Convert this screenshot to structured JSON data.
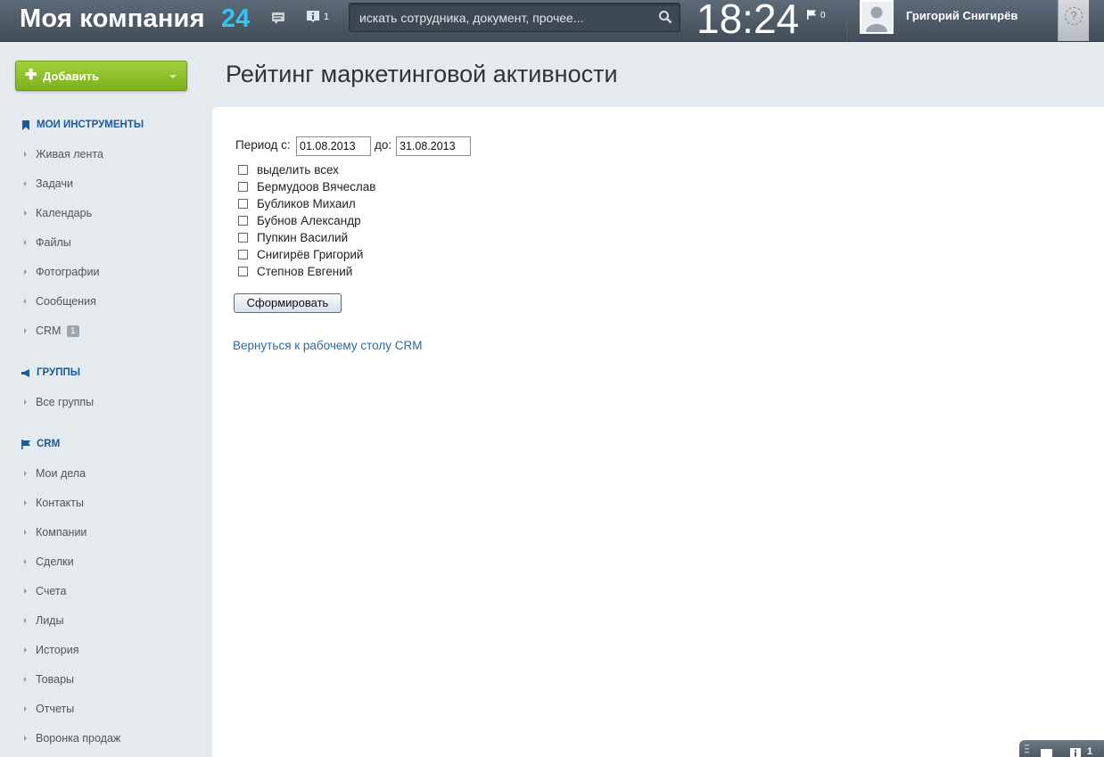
{
  "header": {
    "company": "Моя компания",
    "company_num": "24",
    "notifications_count": "1",
    "search_placeholder": "искать сотрудника, документ, прочее...",
    "clock": "18:24",
    "flags_count": "0",
    "user_name": "Григорий Снигирёв",
    "help_label": "?"
  },
  "sidebar": {
    "add_button": "Добавить",
    "sections": [
      {
        "title": "МОИ ИНСТРУМЕНТЫ",
        "items": [
          "Живая лента",
          "Задачи",
          "Календарь",
          "Файлы",
          "Фотографии",
          "Сообщения",
          "CRM"
        ]
      },
      {
        "title": "ГРУППЫ",
        "items": [
          "Все группы"
        ]
      },
      {
        "title": "CRM",
        "items": [
          "Мои дела",
          "Контакты",
          "Компании",
          "Сделки",
          "Счета",
          "Лиды",
          "История",
          "Товары",
          "Отчеты",
          "Воронка продаж"
        ]
      }
    ],
    "crm_badge": "1"
  },
  "main": {
    "title": "Рейтинг маркетинговой активности",
    "period_from_label": "Период с:",
    "date_from": "01.08.2013",
    "period_to_label": "до:",
    "date_to": "31.08.2013",
    "checkboxes": [
      "выделить всех",
      "Бермудоов Вячеслав",
      "Бубликов Михаил",
      "Бубнов Александр",
      "Пупкин Василий",
      "Снигирёв Григорий",
      "Степнов Евгений"
    ],
    "submit_label": "Сформировать",
    "back_link": "Вернуться к рабочему столу CRM"
  },
  "bottom_bar": {
    "count": "1"
  },
  "colors": {
    "header_bg": "#4a5661",
    "accent_blue": "#2fc6f6",
    "add_button_green": "#8dc128",
    "link_blue": "#2a6aa5",
    "section_title_blue": "#1a5a9e"
  }
}
